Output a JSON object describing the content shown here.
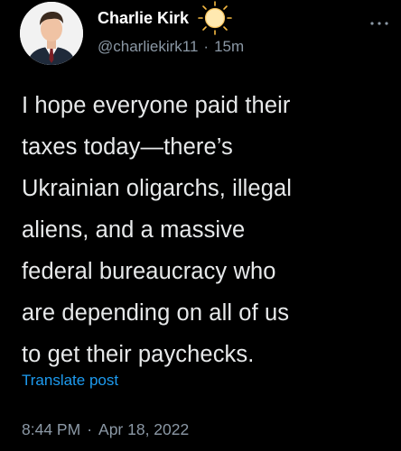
{
  "author": {
    "display_name": "Charlie Kirk",
    "handle": "@charliekirk11",
    "separator": "·",
    "time_ago": "15m",
    "badge_icon": "sun-icon"
  },
  "tweet": {
    "text": "I hope everyone paid their\ntaxes today—there’s\nUkrainian oligarchs, illegal\naliens, and a massive\nfederal bureaucracy who\nare depending on all of us\nto get their paychecks.",
    "translate_label": "Translate post"
  },
  "meta": {
    "time": "8:44 PM",
    "separator": "·",
    "date": "Apr 18, 2022"
  },
  "colors": {
    "background": "#000000",
    "primary_text": "#e7e9ea",
    "secondary_text": "#8b98a5",
    "link": "#1d9bf0"
  }
}
